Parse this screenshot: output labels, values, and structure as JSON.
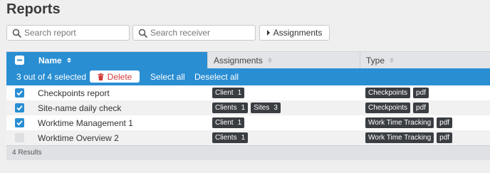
{
  "page": {
    "title": "Reports"
  },
  "toolbar": {
    "search_report_placeholder": "Search report",
    "search_receiver_placeholder": "Search receiver",
    "assignments_label": "Assignments"
  },
  "table": {
    "columns": {
      "name": "Name",
      "assignments": "Assignments",
      "type": "Type"
    },
    "selection": {
      "count_text": "3 out of 4 selected",
      "delete_label": "Delete",
      "select_all_label": "Select all",
      "deselect_all_label": "Deselect all"
    },
    "rows": [
      {
        "name": "Checkpoints report",
        "checked": true,
        "assignments": [
          {
            "label": "Client",
            "count": "1"
          }
        ],
        "types": [
          "Checkpoints",
          "pdf"
        ]
      },
      {
        "name": "Site-name daily check",
        "checked": true,
        "assignments": [
          {
            "label": "Clients",
            "count": "1"
          },
          {
            "label": "Sites",
            "count": "3"
          }
        ],
        "types": [
          "Checkpoints",
          "pdf"
        ]
      },
      {
        "name": "Worktime Management 1",
        "checked": true,
        "assignments": [
          {
            "label": "Client",
            "count": "1"
          }
        ],
        "types": [
          "Work Time Tracking",
          "pdf"
        ]
      },
      {
        "name": "Worktime Overview 2",
        "checked": false,
        "assignments": [
          {
            "label": "Clients",
            "count": "1"
          }
        ],
        "types": [
          "Work Time Tracking",
          "pdf"
        ]
      }
    ],
    "footer_text": "4 Results"
  },
  "colors": {
    "accent": "#2a8ed3",
    "chip": "#3a3d42",
    "danger": "#d23a3a"
  },
  "icons": {
    "search": "magnifier-icon",
    "delete": "trash-icon",
    "checkbox": "check-icon",
    "sort": "sort-arrows-icon"
  }
}
